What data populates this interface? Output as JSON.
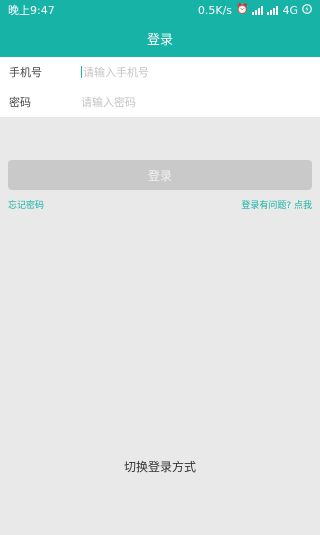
{
  "status_bar": {
    "time": "晚上9:47",
    "speed": "0.5K/s",
    "network": "4G",
    "alarm_icon": "alarm-icon",
    "signal_icon": "signal-icon",
    "charging_icon": "charging-icon"
  },
  "header": {
    "title": "登录"
  },
  "form": {
    "phone_label": "手机号",
    "phone_placeholder": "请输入手机号",
    "password_label": "密码",
    "password_placeholder": "请输入密码"
  },
  "actions": {
    "login_label": "登录",
    "forgot_password": "忘记密码",
    "help_link": "登录有问题? 点我",
    "switch_method": "切换登录方式"
  },
  "colors": {
    "accent": "#16b3a6",
    "button_disabled": "#c9c9c9",
    "background": "#e9e9e9"
  }
}
